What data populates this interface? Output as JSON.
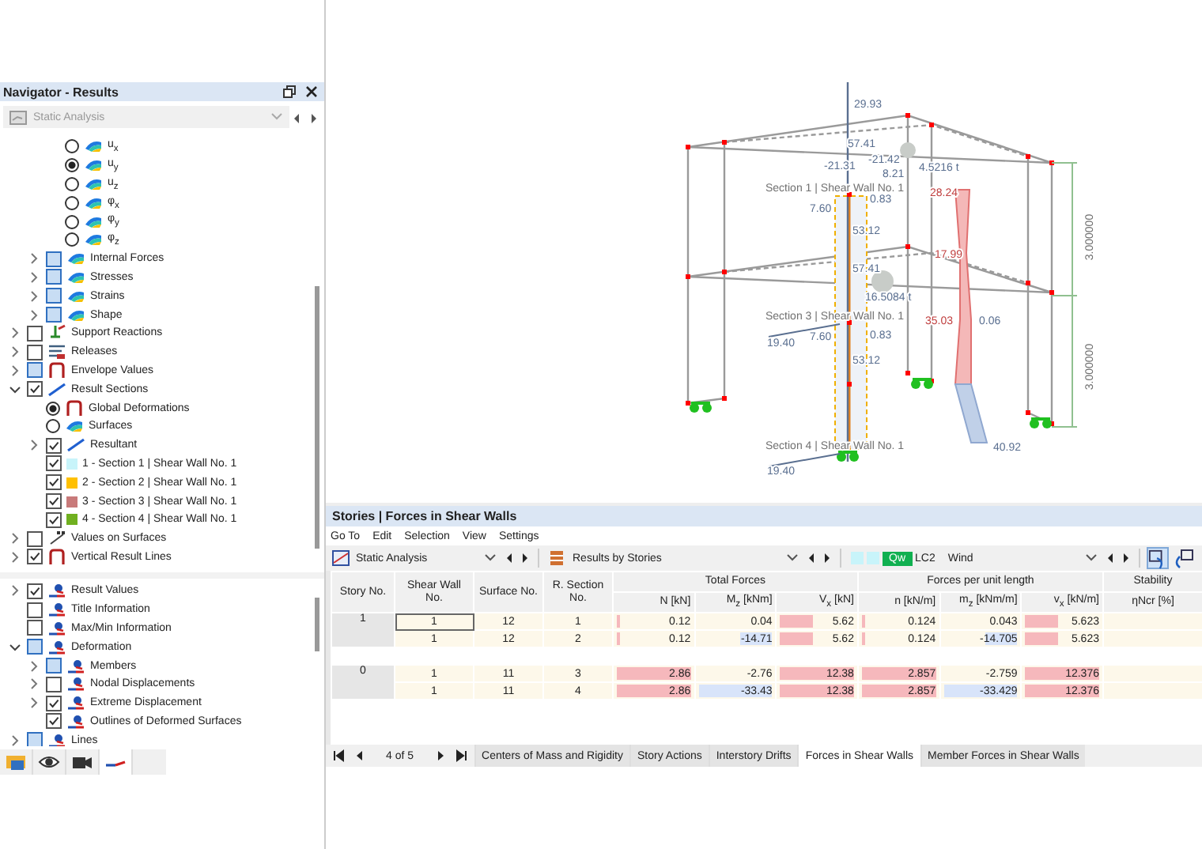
{
  "navigator": {
    "title": "Navigator - Results",
    "analysis": {
      "value": "Static Analysis",
      "disabled": true
    },
    "tree": [
      {
        "kind": "continuation",
        "children": [
          {
            "kind": "continuation",
            "children": [
              {
                "kind": "radio",
                "label": "u$_{x}$",
                "selected": false
              },
              {
                "kind": "radio",
                "label": "u$_{y}$",
                "selected": true
              },
              {
                "kind": "radio",
                "label": "u$_{z}$",
                "selected": false
              },
              {
                "kind": "radio",
                "label": "φ$_{x}$",
                "selected": false
              },
              {
                "kind": "radio",
                "label": "φ$_{y}$",
                "selected": false
              },
              {
                "kind": "radio",
                "label": "φ$_{z}$",
                "selected": false
              }
            ]
          },
          {
            "kind": "checkbox",
            "label": "Internal Forces",
            "checked": false,
            "partial": true,
            "expanded": false
          },
          {
            "kind": "checkbox",
            "label": "Stresses",
            "checked": false,
            "partial": true,
            "expanded": false
          },
          {
            "kind": "checkbox",
            "label": "Strains",
            "checked": false,
            "partial": true,
            "expanded": false
          },
          {
            "kind": "checkbox",
            "label": "Shape",
            "checked": false,
            "partial": true,
            "expanded": false
          }
        ]
      },
      {
        "kind": "checkbox",
        "label": "Support Reactions",
        "checked": false,
        "partial": false,
        "expanded": false
      },
      {
        "kind": "checkbox",
        "label": "Releases",
        "checked": false,
        "partial": false,
        "expanded": false
      },
      {
        "kind": "checkbox",
        "label": "Envelope Values",
        "checked": false,
        "partial": true,
        "expanded": false
      },
      {
        "kind": "checkbox",
        "label": "Result Sections",
        "checked": true,
        "partial": false,
        "expanded": true,
        "children": [
          {
            "kind": "radio",
            "label": "Global Deformations",
            "selected": true
          },
          {
            "kind": "radio",
            "label": "Surfaces",
            "selected": false
          },
          {
            "kind": "checkbox",
            "label": "Resultant",
            "checked": true,
            "partial": false,
            "expanded": false
          },
          {
            "kind": "checkbox",
            "label": "1 - Section 1 | Shear Wall No. 1",
            "checked": true,
            "partial": false,
            "color": "#c8f4fa"
          },
          {
            "kind": "checkbox",
            "label": "2 - Section 2 | Shear Wall No. 1",
            "checked": true,
            "partial": false,
            "color": "#ffc000"
          },
          {
            "kind": "checkbox",
            "label": "3 - Section 3 | Shear Wall No. 1",
            "checked": true,
            "partial": false,
            "color": "#c87a7a"
          },
          {
            "kind": "checkbox",
            "label": "4 - Section 4 | Shear Wall No. 1",
            "checked": true,
            "partial": false,
            "color": "#70b020"
          }
        ]
      },
      {
        "kind": "checkbox",
        "label": "Values on Surfaces",
        "checked": false,
        "partial": false,
        "expanded": false
      },
      {
        "kind": "checkbox",
        "label": "Vertical Result Lines",
        "checked": true,
        "partial": false,
        "expanded": false
      }
    ],
    "display_tree": [
      {
        "kind": "checkbox",
        "label": "Result Values",
        "checked": true,
        "partial": false,
        "expanded": false
      },
      {
        "kind": "checkbox",
        "label": "Title Information",
        "checked": false,
        "partial": false
      },
      {
        "kind": "checkbox",
        "label": "Max/Min Information",
        "checked": false,
        "partial": false
      },
      {
        "kind": "checkbox",
        "label": "Deformation",
        "checked": false,
        "partial": true,
        "expanded": true,
        "children": [
          {
            "kind": "checkbox",
            "label": "Members",
            "checked": false,
            "partial": true,
            "expanded": false
          },
          {
            "kind": "checkbox",
            "label": "Nodal Displacements",
            "checked": false,
            "partial": false,
            "expanded": false
          },
          {
            "kind": "checkbox",
            "label": "Extreme Displacement",
            "checked": true,
            "partial": false,
            "expanded": false
          },
          {
            "kind": "checkbox",
            "label": "Outlines of Deformed Surfaces",
            "checked": true,
            "partial": false
          }
        ]
      },
      {
        "kind": "checkbox",
        "label": "Lines",
        "checked": false,
        "partial": true,
        "expanded": false
      }
    ],
    "tabs": [
      {
        "kind": "data",
        "selected": false
      },
      {
        "kind": "view",
        "selected": false
      },
      {
        "kind": "camera",
        "selected": false
      },
      {
        "kind": "results",
        "selected": true
      }
    ]
  },
  "model_view": {
    "labels": [
      {
        "kind": "value",
        "text": "29.93"
      },
      {
        "kind": "value",
        "text": "57.41"
      },
      {
        "kind": "value",
        "text": "-21.31"
      },
      {
        "kind": "value",
        "text": "-21.42"
      },
      {
        "kind": "value",
        "text": "8.21"
      },
      {
        "kind": "value",
        "text": "4.5216 t"
      },
      {
        "kind": "section-title",
        "text": "Section 1 | Shear Wall No. 1"
      },
      {
        "kind": "diagram-value",
        "text": "28.24"
      },
      {
        "kind": "value",
        "text": "7.60"
      },
      {
        "kind": "value",
        "text": "0.83"
      },
      {
        "kind": "value",
        "text": "53.12"
      },
      {
        "kind": "diagram-value",
        "text": "17.99"
      },
      {
        "kind": "value",
        "text": "57.41"
      },
      {
        "kind": "value",
        "text": "16.5084 t"
      },
      {
        "kind": "section-title",
        "text": "Section 3 | Shear Wall No. 1"
      },
      {
        "kind": "diagram-value",
        "text": "35.03"
      },
      {
        "kind": "value",
        "text": "0.06"
      },
      {
        "kind": "value",
        "text": "19.40"
      },
      {
        "kind": "value",
        "text": "7.60"
      },
      {
        "kind": "value",
        "text": "0.83"
      },
      {
        "kind": "value",
        "text": "53.12"
      },
      {
        "kind": "section-title",
        "text": "Section 4 | Shear Wall No. 1"
      },
      {
        "kind": "value",
        "text": "19.40"
      },
      {
        "kind": "value",
        "text": "40.92"
      },
      {
        "kind": "dimension",
        "text": "3.000000"
      },
      {
        "kind": "dimension",
        "text": "3.000000"
      }
    ]
  },
  "table_panel": {
    "title": "Stories | Forces in Shear Walls",
    "menu": [
      "Go To",
      "Edit",
      "Selection",
      "View",
      "Settings"
    ],
    "analysis": "Static Analysis",
    "result_type": "Results by Stories",
    "load_case": {
      "badge": "Qw",
      "code": "LC2",
      "name": "Wind"
    },
    "tools": [
      {
        "selected": true
      },
      {
        "selected": false
      }
    ],
    "columns": {
      "story": "Story No.",
      "wall": "Shear Wall No.",
      "surface": "Surface No.",
      "section": "R. Section No.",
      "total_group": "Total Forces",
      "unit_group": "Forces per unit length",
      "stability_group": "Stability",
      "values": [
        "N [kN]",
        "M$_{z}$ [kNm]",
        "V$_{x}$ [kN]",
        "n [kN/m]",
        "m$_{z}$ [kNm/m]",
        "v$_{x}$ [kN/m]"
      ],
      "stability": "ηNcr [%]"
    },
    "groups": [
      {
        "story": "1",
        "rows": [
          {
            "wall": "1",
            "surface": "12",
            "section": "1",
            "focus": true,
            "values": [
              {
                "text": "0.12",
                "level": 0.04,
                "negative": false
              },
              {
                "text": "0.04"
              },
              {
                "text": "5.62",
                "level": 0.45,
                "negative": false
              },
              {
                "text": "0.124",
                "level": 0.04,
                "negative": false
              },
              {
                "text": "0.043"
              },
              {
                "text": "5.623",
                "level": 0.45,
                "negative": false
              }
            ]
          },
          {
            "wall": "1",
            "surface": "12",
            "section": "2",
            "focus": false,
            "values": [
              {
                "text": "0.12",
                "level": 0.04,
                "negative": false
              },
              {
                "text": "-14.71",
                "level": 0.44,
                "negative": true
              },
              {
                "text": "5.62",
                "level": 0.45,
                "negative": false
              },
              {
                "text": "0.124",
                "level": 0.04,
                "negative": false
              },
              {
                "text": "-14.705",
                "level": 0.44,
                "negative": true
              },
              {
                "text": "5.623",
                "level": 0.45,
                "negative": false
              }
            ]
          }
        ]
      },
      {
        "story": "0",
        "rows": [
          {
            "wall": "1",
            "surface": "11",
            "section": "3",
            "focus": false,
            "values": [
              {
                "text": "2.86",
                "level": 1,
                "negative": false
              },
              {
                "text": "-2.76"
              },
              {
                "text": "12.38",
                "level": 1,
                "negative": false
              },
              {
                "text": "2.857",
                "level": 1,
                "negative": false
              },
              {
                "text": "-2.759"
              },
              {
                "text": "12.376",
                "level": 1,
                "negative": false
              }
            ]
          },
          {
            "wall": "1",
            "surface": "11",
            "section": "4",
            "focus": false,
            "values": [
              {
                "text": "2.86",
                "level": 1,
                "negative": false
              },
              {
                "text": "-33.43",
                "level": 1,
                "negative": true
              },
              {
                "text": "12.38",
                "level": 1,
                "negative": false
              },
              {
                "text": "2.857",
                "level": 1,
                "negative": false
              },
              {
                "text": "-33.429",
                "level": 1,
                "negative": true
              },
              {
                "text": "12.376",
                "level": 1,
                "negative": false
              }
            ]
          }
        ]
      }
    ],
    "pager": "4 of 5",
    "tabs": [
      {
        "label": "Centers of Mass and Rigidity",
        "selected": false
      },
      {
        "label": "Story Actions",
        "selected": false
      },
      {
        "label": "Interstory Drifts",
        "selected": false
      },
      {
        "label": "Forces in Shear Walls",
        "selected": true
      },
      {
        "label": "Member Forces in Shear Walls",
        "selected": false
      }
    ]
  }
}
